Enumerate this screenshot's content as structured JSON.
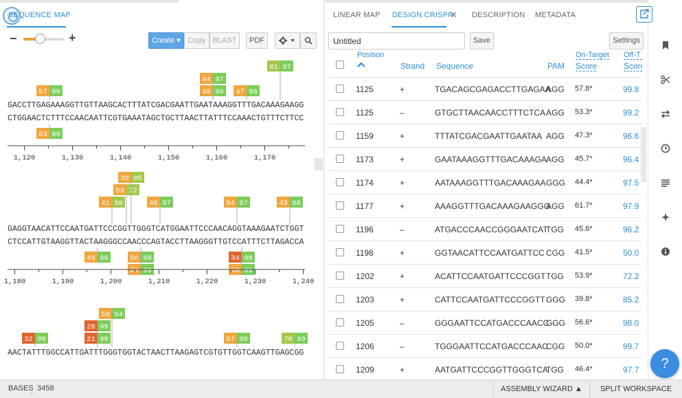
{
  "left_panel": {
    "tab_label": "SEQUENCE MAP",
    "toolbar": {
      "zoom_minus": "−",
      "zoom_plus": "+",
      "zoom_level": 0.4,
      "create_label": "Create ▾",
      "copy_label": "Copy",
      "blast_label": "BLAST",
      "pdf_label": "PDF",
      "gear_icon": "gear-icon",
      "search_icon": "search-icon"
    },
    "sequence_map": {
      "blocks": [
        {
          "top_strand": "GACCTTGAGAAAGGTTGTTAAGCACTTTATCGACGAATTGAATAAAGGTTTGACAAAGAAGG",
          "bottom_strand": "CTGGAACTCTTTCCAACAATTCGTGAAATAGCTGCTTAACTTATTTCCAAACTGTTTCTTCC",
          "ticks": [
            "1,120",
            "1,130",
            "1,140",
            "1,150",
            "1,160",
            "1,170"
          ],
          "top_markers": [
            [
              "57",
              "99"
            ],
            [
              "47",
              "96"
            ],
            [
              "45",
              "96"
            ],
            [
              "44",
              "97"
            ],
            [
              "61",
              "97"
            ]
          ],
          "bottom_markers": [
            [
              "53",
              "99"
            ]
          ]
        },
        {
          "top_strand": "GAGGTAACATTCCAATGATTCCCGGTTGGGTCATGGAATTCCCAACAGGTAAAGAATCTGGT",
          "bottom_strand": "CTCCATTGTAAGGTTACTAAGGGCCAACCCAGTACCTTAAGGGTTGTCCATTTCTTAGACCA",
          "ticks": [
            "1,180",
            "1,190",
            "1,200",
            "1,210",
            "1,220",
            "1,230",
            "1,240"
          ],
          "top_markers": [
            [
              "41",
              "50"
            ],
            [
              "53",
              "72"
            ],
            [
              "39",
              "85"
            ],
            [
              "46",
              "97"
            ],
            [
              "54",
              "97"
            ],
            [
              "43",
              "98"
            ]
          ],
          "bottom_markers": [
            [
              "45",
              "96"
            ],
            [
              "56",
              "98"
            ],
            [
              "50",
              "99"
            ],
            [
              "34",
              "98"
            ],
            [
              "50",
              "99"
            ]
          ]
        },
        {
          "top_strand": "AACTATTTGGCCATTGATTTGGGTGGTACTAACTTAAGAGTCGTGTTGGTCAAGTTGAGCGG",
          "bottom_strand": "",
          "ticks": [],
          "top_markers": [
            [
              "32",
              "99"
            ],
            [
              "21",
              "99"
            ],
            [
              "28",
              "99"
            ],
            [
              "59",
              "94"
            ],
            [
              "57",
              "99"
            ],
            [
              "70",
              "99"
            ]
          ],
          "bottom_markers": []
        }
      ]
    }
  },
  "right_panel": {
    "tabs": [
      {
        "label": "LINEAR MAP",
        "active": false
      },
      {
        "label": "DESIGN CRISPR",
        "active": true
      },
      {
        "label": "DESCRIPTION",
        "active": false
      },
      {
        "label": "METADATA",
        "active": false
      }
    ],
    "tab_close_icon": "close-icon",
    "name_value": "Untitled",
    "save_label": "Save",
    "settings_label": "Settings",
    "columns": {
      "position": "Position",
      "strand": "Strand",
      "sequence": "Sequence",
      "pam": "PAM",
      "on_target_1": "On-Target",
      "on_target_2": "Score",
      "off_target_1": "Off-T",
      "off_target_2": "Score"
    },
    "sort_icon": "caret-up-icon",
    "rows": [
      {
        "position": "1125",
        "strand": "+",
        "sequence": "TGACAGCGAGACCTTGAGAA",
        "pam": "AGG",
        "on_target": "57.8*",
        "off_target": "99.8"
      },
      {
        "position": "1125",
        "strand": "–",
        "sequence": "GTGCTTAACAACCTTTCTCA",
        "pam": "AGG",
        "on_target": "53.3*",
        "off_target": "99.2"
      },
      {
        "position": "1159",
        "strand": "+",
        "sequence": "TTTATCGACGAATTGAATAA",
        "pam": "AGG",
        "on_target": "47.3*",
        "off_target": "96.6"
      },
      {
        "position": "1173",
        "strand": "+",
        "sequence": "GAATAAAGGTTTGACAAAGA",
        "pam": "AGG",
        "on_target": "45.7*",
        "off_target": "96.4"
      },
      {
        "position": "1174",
        "strand": "+",
        "sequence": "AATAAAGGTTTGACAAAGAA",
        "pam": "GGG",
        "on_target": "44.4*",
        "off_target": "97.5"
      },
      {
        "position": "1177",
        "strand": "+",
        "sequence": "AAAGGTTTGACAAAGAAGGG",
        "pam": "AGG",
        "on_target": "61.7*",
        "off_target": "97.9"
      },
      {
        "position": "1196",
        "strand": "–",
        "sequence": "ATGACCCAACCGGGAATCAT",
        "pam": "TGG",
        "on_target": "45.6*",
        "off_target": "96.2"
      },
      {
        "position": "1198",
        "strand": "+",
        "sequence": "GGTAACATTCCAATGATTCC",
        "pam": "CGG",
        "on_target": "41.5*",
        "off_target": "50.0"
      },
      {
        "position": "1202",
        "strand": "+",
        "sequence": "ACATTCCAATGATTCCCGGT",
        "pam": "TGG",
        "on_target": "53.9*",
        "off_target": "72.2"
      },
      {
        "position": "1203",
        "strand": "+",
        "sequence": "CATTCCAATGATTCCCGGTT",
        "pam": "GGG",
        "on_target": "39.8*",
        "off_target": "85.2"
      },
      {
        "position": "1205",
        "strand": "–",
        "sequence": "GGGAATTCCATGACCCAACC",
        "pam": "GGG",
        "on_target": "56.6*",
        "off_target": "98.0"
      },
      {
        "position": "1206",
        "strand": "–",
        "sequence": "TGGGAATTCCATGACCCAAC",
        "pam": "CGG",
        "on_target": "50.0*",
        "off_target": "99.7"
      },
      {
        "position": "1209",
        "strand": "+",
        "sequence": "AATGATTCCCGGTTGGGTCA",
        "pam": "TGG",
        "on_target": "46.4*",
        "off_target": "97.7"
      }
    ]
  },
  "rail": {
    "icons": [
      "bookmark-icon",
      "scissors-icon",
      "swap-icon",
      "clock-icon",
      "lines-icon",
      "puzzle-icon",
      "info-icon"
    ],
    "help_label": "?"
  },
  "footer": {
    "bases_label": "BASES",
    "bases_value": "3458",
    "wizard_label": "ASSEMBLY WIZARD ▲",
    "split_label": "SPLIT WORKSPACE"
  },
  "colors": {
    "accent": "#2d8fd5",
    "marker_orange": "#f0a640",
    "marker_red": "#e0652e",
    "marker_green": "#7ccd5a",
    "marker_olive": "#a3c84a"
  }
}
